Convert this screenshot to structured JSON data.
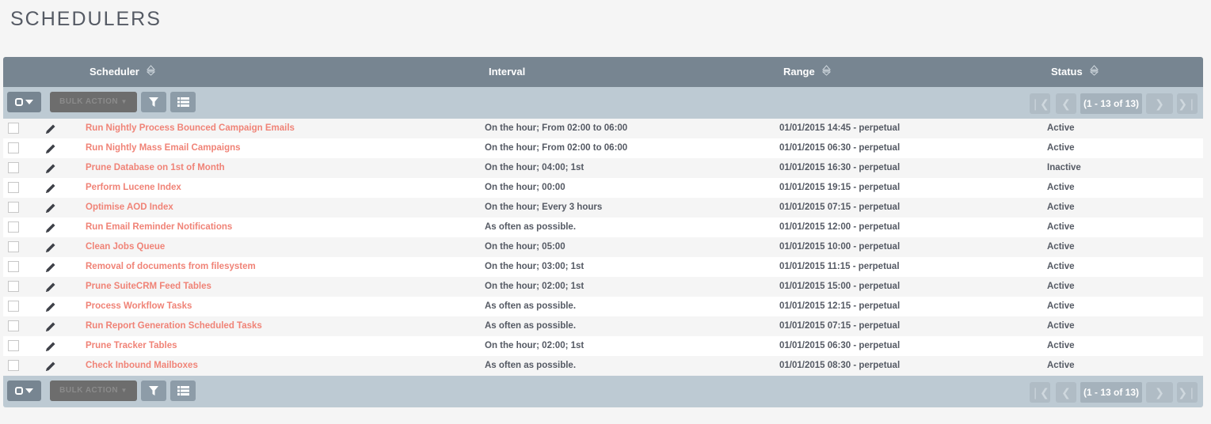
{
  "page": {
    "title": "SCHEDULERS"
  },
  "columns": {
    "scheduler": "Scheduler",
    "interval": "Interval",
    "range": "Range",
    "status": "Status"
  },
  "toolbar": {
    "bulk_action_label": "BULK ACTION",
    "pagination_label": "(1 - 13 of 13)"
  },
  "rows": [
    {
      "name": "Run Nightly Process Bounced Campaign Emails",
      "interval": "On the hour; From 02:00 to 06:00",
      "range": "01/01/2015 14:45 - perpetual",
      "status": "Active"
    },
    {
      "name": "Run Nightly Mass Email Campaigns",
      "interval": "On the hour; From 02:00 to 06:00",
      "range": "01/01/2015 06:30 - perpetual",
      "status": "Active"
    },
    {
      "name": "Prune Database on 1st of Month",
      "interval": "On the hour; 04:00; 1st",
      "range": "01/01/2015 16:30 - perpetual",
      "status": "Inactive"
    },
    {
      "name": "Perform Lucene Index",
      "interval": "On the hour; 00:00",
      "range": "01/01/2015 19:15 - perpetual",
      "status": "Active"
    },
    {
      "name": "Optimise AOD Index",
      "interval": "On the hour; Every 3 hours",
      "range": "01/01/2015 07:15 - perpetual",
      "status": "Active"
    },
    {
      "name": "Run Email Reminder Notifications",
      "interval": "As often as possible.",
      "range": "01/01/2015 12:00 - perpetual",
      "status": "Active"
    },
    {
      "name": "Clean Jobs Queue",
      "interval": "On the hour; 05:00",
      "range": "01/01/2015 10:00 - perpetual",
      "status": "Active"
    },
    {
      "name": "Removal of documents from filesystem",
      "interval": "On the hour; 03:00; 1st",
      "range": "01/01/2015 11:15 - perpetual",
      "status": "Active"
    },
    {
      "name": "Prune SuiteCRM Feed Tables",
      "interval": "On the hour; 02:00; 1st",
      "range": "01/01/2015 15:00 - perpetual",
      "status": "Active"
    },
    {
      "name": "Process Workflow Tasks",
      "interval": "As often as possible.",
      "range": "01/01/2015 12:15 - perpetual",
      "status": "Active"
    },
    {
      "name": "Run Report Generation Scheduled Tasks",
      "interval": "As often as possible.",
      "range": "01/01/2015 07:15 - perpetual",
      "status": "Active"
    },
    {
      "name": "Prune Tracker Tables",
      "interval": "On the hour; 02:00; 1st",
      "range": "01/01/2015 06:30 - perpetual",
      "status": "Active"
    },
    {
      "name": "Check Inbound Mailboxes",
      "interval": "As often as possible.",
      "range": "01/01/2015 08:30 - perpetual",
      "status": "Active"
    }
  ],
  "icons": {
    "select_all": "checkbox-dropdown-icon",
    "filter": "filter-icon",
    "column_chooser": "list-columns-icon",
    "edit": "pencil-icon",
    "sort": "sort-icon",
    "first": "first-page-icon",
    "prev": "previous-page-icon",
    "next": "next-page-icon",
    "last": "last-page-icon"
  },
  "colors": {
    "header_bg": "#778591",
    "toolbar_bg": "#bdcad3",
    "link": "#f08377"
  }
}
